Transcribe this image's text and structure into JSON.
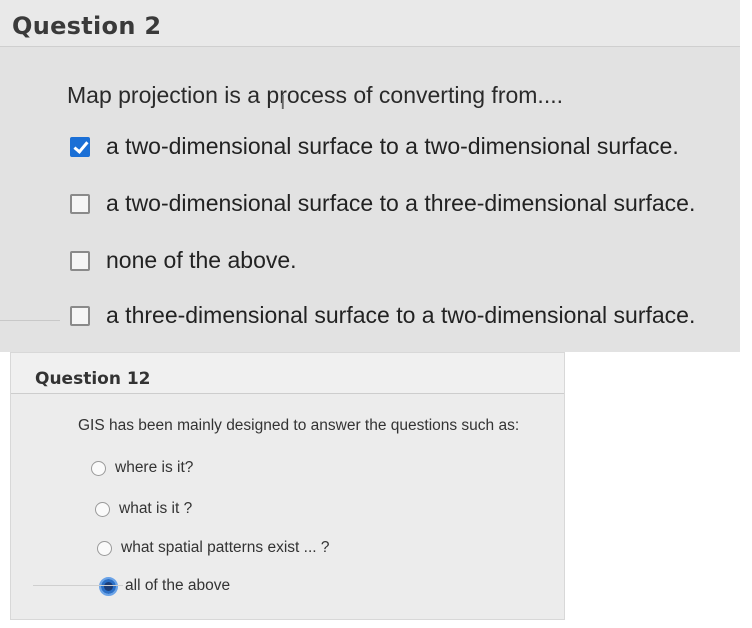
{
  "q1": {
    "title": "Question 2",
    "text": "Map projection is a process of converting from....",
    "options": [
      {
        "label": "a two-dimensional surface to a two-dimensional surface.",
        "checked": true
      },
      {
        "label": "a two-dimensional surface to a three-dimensional surface.",
        "checked": false
      },
      {
        "label": "none of the above.",
        "checked": false
      },
      {
        "label": "a three-dimensional surface to a two-dimensional surface.",
        "checked": false
      }
    ]
  },
  "q2": {
    "title": "Question 12",
    "text": "GIS has been mainly designed to answer the questions such as:",
    "options": [
      {
        "label": "where is it?",
        "selected": false
      },
      {
        "label": "what is it ?",
        "selected": false
      },
      {
        "label": "what spatial patterns exist ... ?",
        "selected": false
      },
      {
        "label": "all of the above",
        "selected": true
      }
    ]
  },
  "colors": {
    "checkbox_accent": "#1a6fd6",
    "radio_selected": "#1c3d78"
  }
}
